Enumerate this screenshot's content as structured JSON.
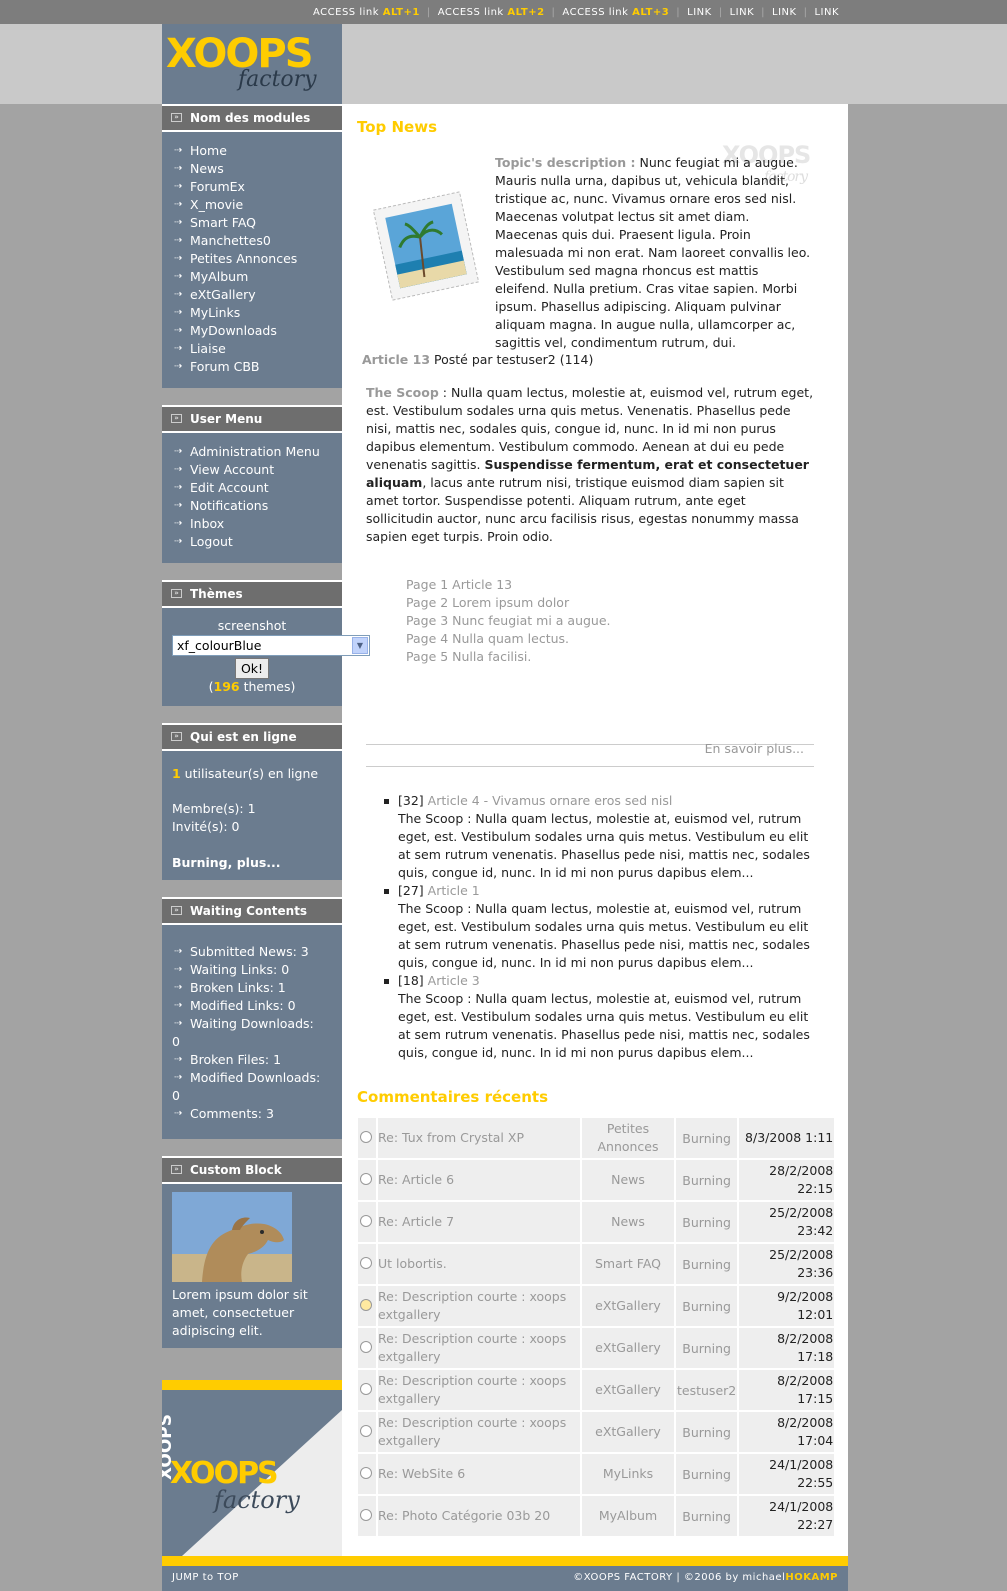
{
  "topbar": {
    "access_links": [
      {
        "label": "ACCESS link",
        "key": "ALT+1"
      },
      {
        "label": "ACCESS link",
        "key": "ALT+2"
      },
      {
        "label": "ACCESS link",
        "key": "ALT+3"
      }
    ],
    "links": [
      "LINK",
      "LINK",
      "LINK",
      "LINK"
    ],
    "separator": "|"
  },
  "logo": {
    "word": "XOOPS",
    "sub": "factory"
  },
  "colors": {
    "accent": "#ffcc00",
    "sidebar": "#6b7c8f",
    "header_band": "#c9c9c9",
    "topbar": "#7d7d7d",
    "page_bg": "#a3a3a3"
  },
  "modules_block": {
    "title": "Nom des modules",
    "items": [
      "Home",
      "News",
      "ForumEx",
      "X_movie",
      "Smart FAQ",
      "Manchettes0",
      "Petites Annonces",
      "MyAlbum",
      "eXtGallery",
      "MyLinks",
      "MyDownloads",
      "Liaise",
      "Forum CBB"
    ]
  },
  "user_menu": {
    "title": "User Menu",
    "items": [
      "Administration Menu",
      "View Account",
      "Edit Account",
      "Notifications",
      "Inbox",
      "Logout"
    ]
  },
  "themes_block": {
    "title": "Thèmes",
    "caption": "screenshot",
    "selected": "xf_colourBlue",
    "ok": "Ok!",
    "count_open": "(",
    "count": "196",
    "count_suffix": " themes)"
  },
  "online_block": {
    "title": "Qui est en ligne",
    "users_count": "1",
    "users_label": " utilisateur(s) en ligne",
    "members": "Membre(s): 1",
    "guests": "Invité(s): 0",
    "user_link": "Burning",
    "comma": ", ",
    "more_link": "plus..."
  },
  "waiting_block": {
    "title": "Waiting Contents",
    "items": [
      "Submitted News: 3",
      "Waiting Links: 0",
      "Broken Links: 1",
      "Modified Links: 0",
      "Waiting Downloads:",
      "Broken Files: 1",
      "Modified Downloads:",
      "Comments: 3"
    ],
    "wrap_values": [
      "0",
      "0"
    ]
  },
  "custom_block": {
    "title": "Custom Block",
    "text": "Lorem ipsum dolor sit amet, consectetuer adipiscing elit."
  },
  "left_logo": {
    "vertical": "XOOPS",
    "word": "XOOPS",
    "sub": "factory"
  },
  "top_news": {
    "title": "Top News",
    "watermark": "XOOPS",
    "watermark_sub": "factory",
    "topic_label": "Topic's description :",
    "topic_text": " Nunc feugiat mi a augue. Mauris nulla urna, dapibus ut, vehicula blandit, tristique ac, nunc. Vivamus ornare eros sed nisl. Maecenas volutpat lectus sit amet diam. Maecenas quis dui. Praesent ligula. Proin malesuada mi non erat. Nam laoreet convallis leo. Vestibulum sed magna rhoncus est mattis eleifend. Nulla pretium. Cras vitae sapien. Morbi ipsum. Phasellus adipiscing. Aliquam pulvinar aliquam magna. In augue nulla, ullamcorper ac, sagittis vel, condimentum rutrum, dui.",
    "article_label": "Article 13",
    "posted_by": " Posté par testuser2 (114)",
    "scoop_label": "The Scoop",
    "scoop_text_1": " : Nulla quam lectus, molestie at, euismod vel, rutrum eget, est. Vestibulum sodales urna quis metus. Venenatis. Phasellus pede nisi, mattis nec, sodales quis, congue id, nunc. In id mi non purus dapibus elementum. Vestibulum commodo. Aenean at dui eu pede venenatis sagittis. ",
    "scoop_bold": "Suspendisse fermentum, erat et consectetuer aliquam",
    "scoop_text_2": ", lacus ante rutrum nisi, tristique euismod diam sapien sit amet tortor. Suspendisse potenti. Aliquam rutrum, ante eget sollicitudin auctor, nunc arcu facilisis risus, egestas nonummy massa sapien eget turpis. Proin odio.",
    "pages": [
      "Page 1 Article 13",
      "Page 2 Lorem ipsum dolor",
      "Page 3 Nunc feugiat mi a augue.",
      "Page 4 Nulla quam lectus.",
      "Page 5 Nulla facilisi."
    ],
    "more": "En savoir plus..."
  },
  "other_news": [
    {
      "count": "[32]",
      "title": "Article 4 - Vivamus ornare eros sed nisl",
      "text": "The Scoop : Nulla quam lectus, molestie at, euismod vel, rutrum eget, est. Vestibulum sodales urna quis metus. Vestibulum eu elit at sem rutrum venenatis. Phasellus pede nisi, mattis nec, sodales quis, congue id, nunc. In id mi non purus dapibus elem..."
    },
    {
      "count": "[27]",
      "title": "Article 1",
      "text": "The Scoop : Nulla quam lectus, molestie at, euismod vel, rutrum eget, est. Vestibulum sodales urna quis metus. Vestibulum eu elit at sem rutrum venenatis. Phasellus pede nisi, mattis nec, sodales quis, congue id, nunc. In id mi non purus dapibus elem..."
    },
    {
      "count": "[18]",
      "title": "Article 3",
      "text": "The Scoop : Nulla quam lectus, molestie at, euismod vel, rutrum eget, est. Vestibulum sodales urna quis metus. Vestibulum eu elit at sem rutrum venenatis. Phasellus pede nisi, mattis nec, sodales quis, congue id, nunc. In id mi non purus dapibus elem..."
    }
  ],
  "comments": {
    "title": "Commentaires récents",
    "rows": [
      {
        "subject": "Re: Tux from Crystal XP",
        "module": "Petites Annonces",
        "user": "Burning",
        "date": "8/3/2008 1:11",
        "icon": "circle-icon"
      },
      {
        "subject": "Re: Article 6",
        "module": "News",
        "user": "Burning",
        "date": "28/2/2008 22:15",
        "icon": "circle-icon"
      },
      {
        "subject": "Re: Article 7",
        "module": "News",
        "user": "Burning",
        "date": "25/2/2008 23:42",
        "icon": "circle-icon"
      },
      {
        "subject": "Ut lobortis.",
        "module": "Smart FAQ",
        "user": "Burning",
        "date": "25/2/2008 23:36",
        "icon": "circle-icon"
      },
      {
        "subject": "Re: Description courte : xoops extgallery",
        "module": "eXtGallery",
        "user": "Burning",
        "date": "9/2/2008 12:01",
        "icon": "smiley-icon"
      },
      {
        "subject": "Re: Description courte : xoops extgallery",
        "module": "eXtGallery",
        "user": "Burning",
        "date": "8/2/2008 17:18",
        "icon": "circle-icon"
      },
      {
        "subject": "Re: Description courte : xoops extgallery",
        "module": "eXtGallery",
        "user": "testuser2",
        "date": "8/2/2008 17:15",
        "icon": "circle-icon"
      },
      {
        "subject": "Re: Description courte : xoops extgallery",
        "module": "eXtGallery",
        "user": "Burning",
        "date": "8/2/2008 17:04",
        "icon": "circle-icon"
      },
      {
        "subject": "Re: WebSite 6",
        "module": "MyLinks",
        "user": "Burning",
        "date": "24/1/2008 22:55",
        "icon": "circle-icon"
      },
      {
        "subject": "Re: Photo Catégorie 03b 20",
        "module": "MyAlbum",
        "user": "Burning",
        "date": "24/1/2008 22:27",
        "icon": "circle-icon"
      }
    ]
  },
  "footer": {
    "jump": "JUMP to TOP",
    "copyright": "©XOOPS FACTORY | ©2006 by michael",
    "author": "HOKAMP"
  }
}
